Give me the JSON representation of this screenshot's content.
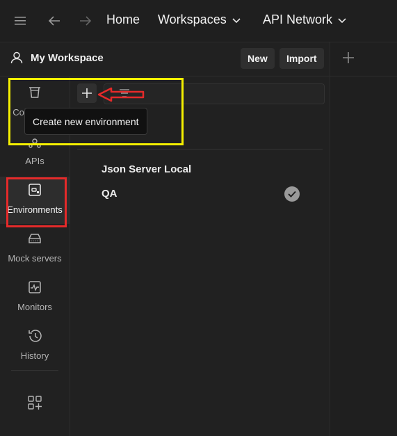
{
  "topbar": {
    "icons": [
      "menu-icon",
      "back-arrow-icon",
      "forward-arrow-icon"
    ],
    "nav": [
      {
        "label": "Home",
        "has_chevron": false
      },
      {
        "label": "Workspaces",
        "has_chevron": true
      },
      {
        "label": "API Network",
        "has_chevron": true
      }
    ]
  },
  "workspace": {
    "title": "My Workspace",
    "icon": "user-icon",
    "new_label": "New",
    "import_label": "Import"
  },
  "right_pane": {
    "icon": "plus-icon"
  },
  "sidebar": {
    "items": [
      {
        "label": "Collections",
        "icon": "trash-can-collections-icon",
        "active": false
      },
      {
        "label": "APIs",
        "icon": "api-nodes-icon",
        "active": false
      },
      {
        "label": "Environments",
        "icon": "environment-icon",
        "active": true
      },
      {
        "label": "Mock servers",
        "icon": "mock-server-icon",
        "active": false
      },
      {
        "label": "Monitors",
        "icon": "monitor-icon",
        "active": false
      },
      {
        "label": "History",
        "icon": "history-icon",
        "active": false
      }
    ],
    "bottom_icon": "apps-add-icon"
  },
  "toolbar": {
    "create_icon": "plus-icon",
    "filter_icon": "filter-lines-icon",
    "tooltip": "Create new environment"
  },
  "environments": [
    {
      "name": "Json Server Local",
      "active": false
    },
    {
      "name": "QA",
      "active": true
    }
  ],
  "colors": {
    "background": "#212121",
    "highlight_yellow": "#f5f000",
    "highlight_red": "#e52a2a",
    "active_check": "#9a9a9a"
  }
}
